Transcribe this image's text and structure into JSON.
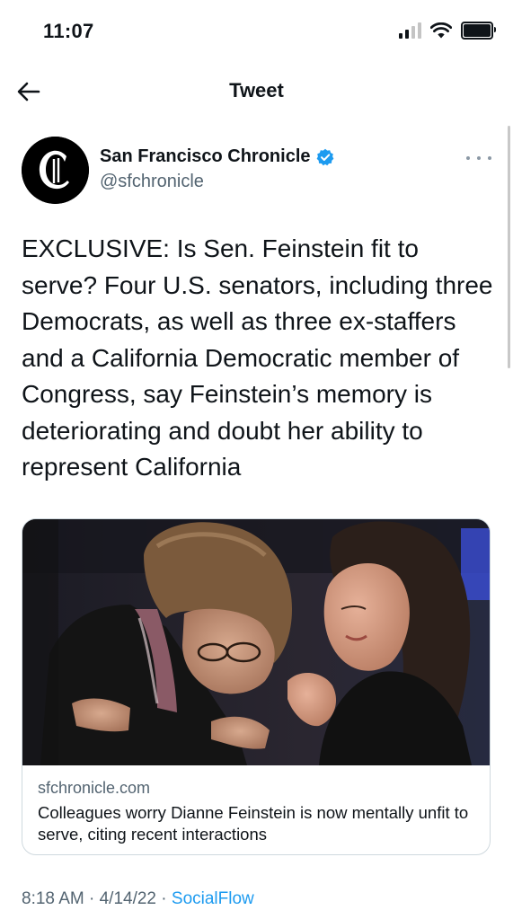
{
  "status_bar": {
    "time": "11:07",
    "icons": [
      "signal-icon",
      "wifi-icon",
      "battery-icon"
    ]
  },
  "header": {
    "title": "Tweet",
    "back_icon": "arrow-left-icon"
  },
  "tweet": {
    "author_name": "San Francisco Chronicle",
    "author_handle": "@sfchronicle",
    "verified": true,
    "verified_color": "#1d9bf0",
    "text": "EXCLUSIVE: Is Sen. Feinstein fit to serve? Four U.S. senators, including three Democrats, as well as three ex-staffers and a California Democratic member of Congress, say Feinstein’s memory is deteriorating and doubt her ability to represent California",
    "card": {
      "domain": "sfchronicle.com",
      "title": "Colleagues worry Dianne Feinstein is now mentally unfit to serve, citing recent interactions"
    },
    "time": "8:18 AM",
    "separator": "·",
    "date": "4/14/22",
    "source": "SocialFlow",
    "source_color": "#1d9bf0"
  }
}
